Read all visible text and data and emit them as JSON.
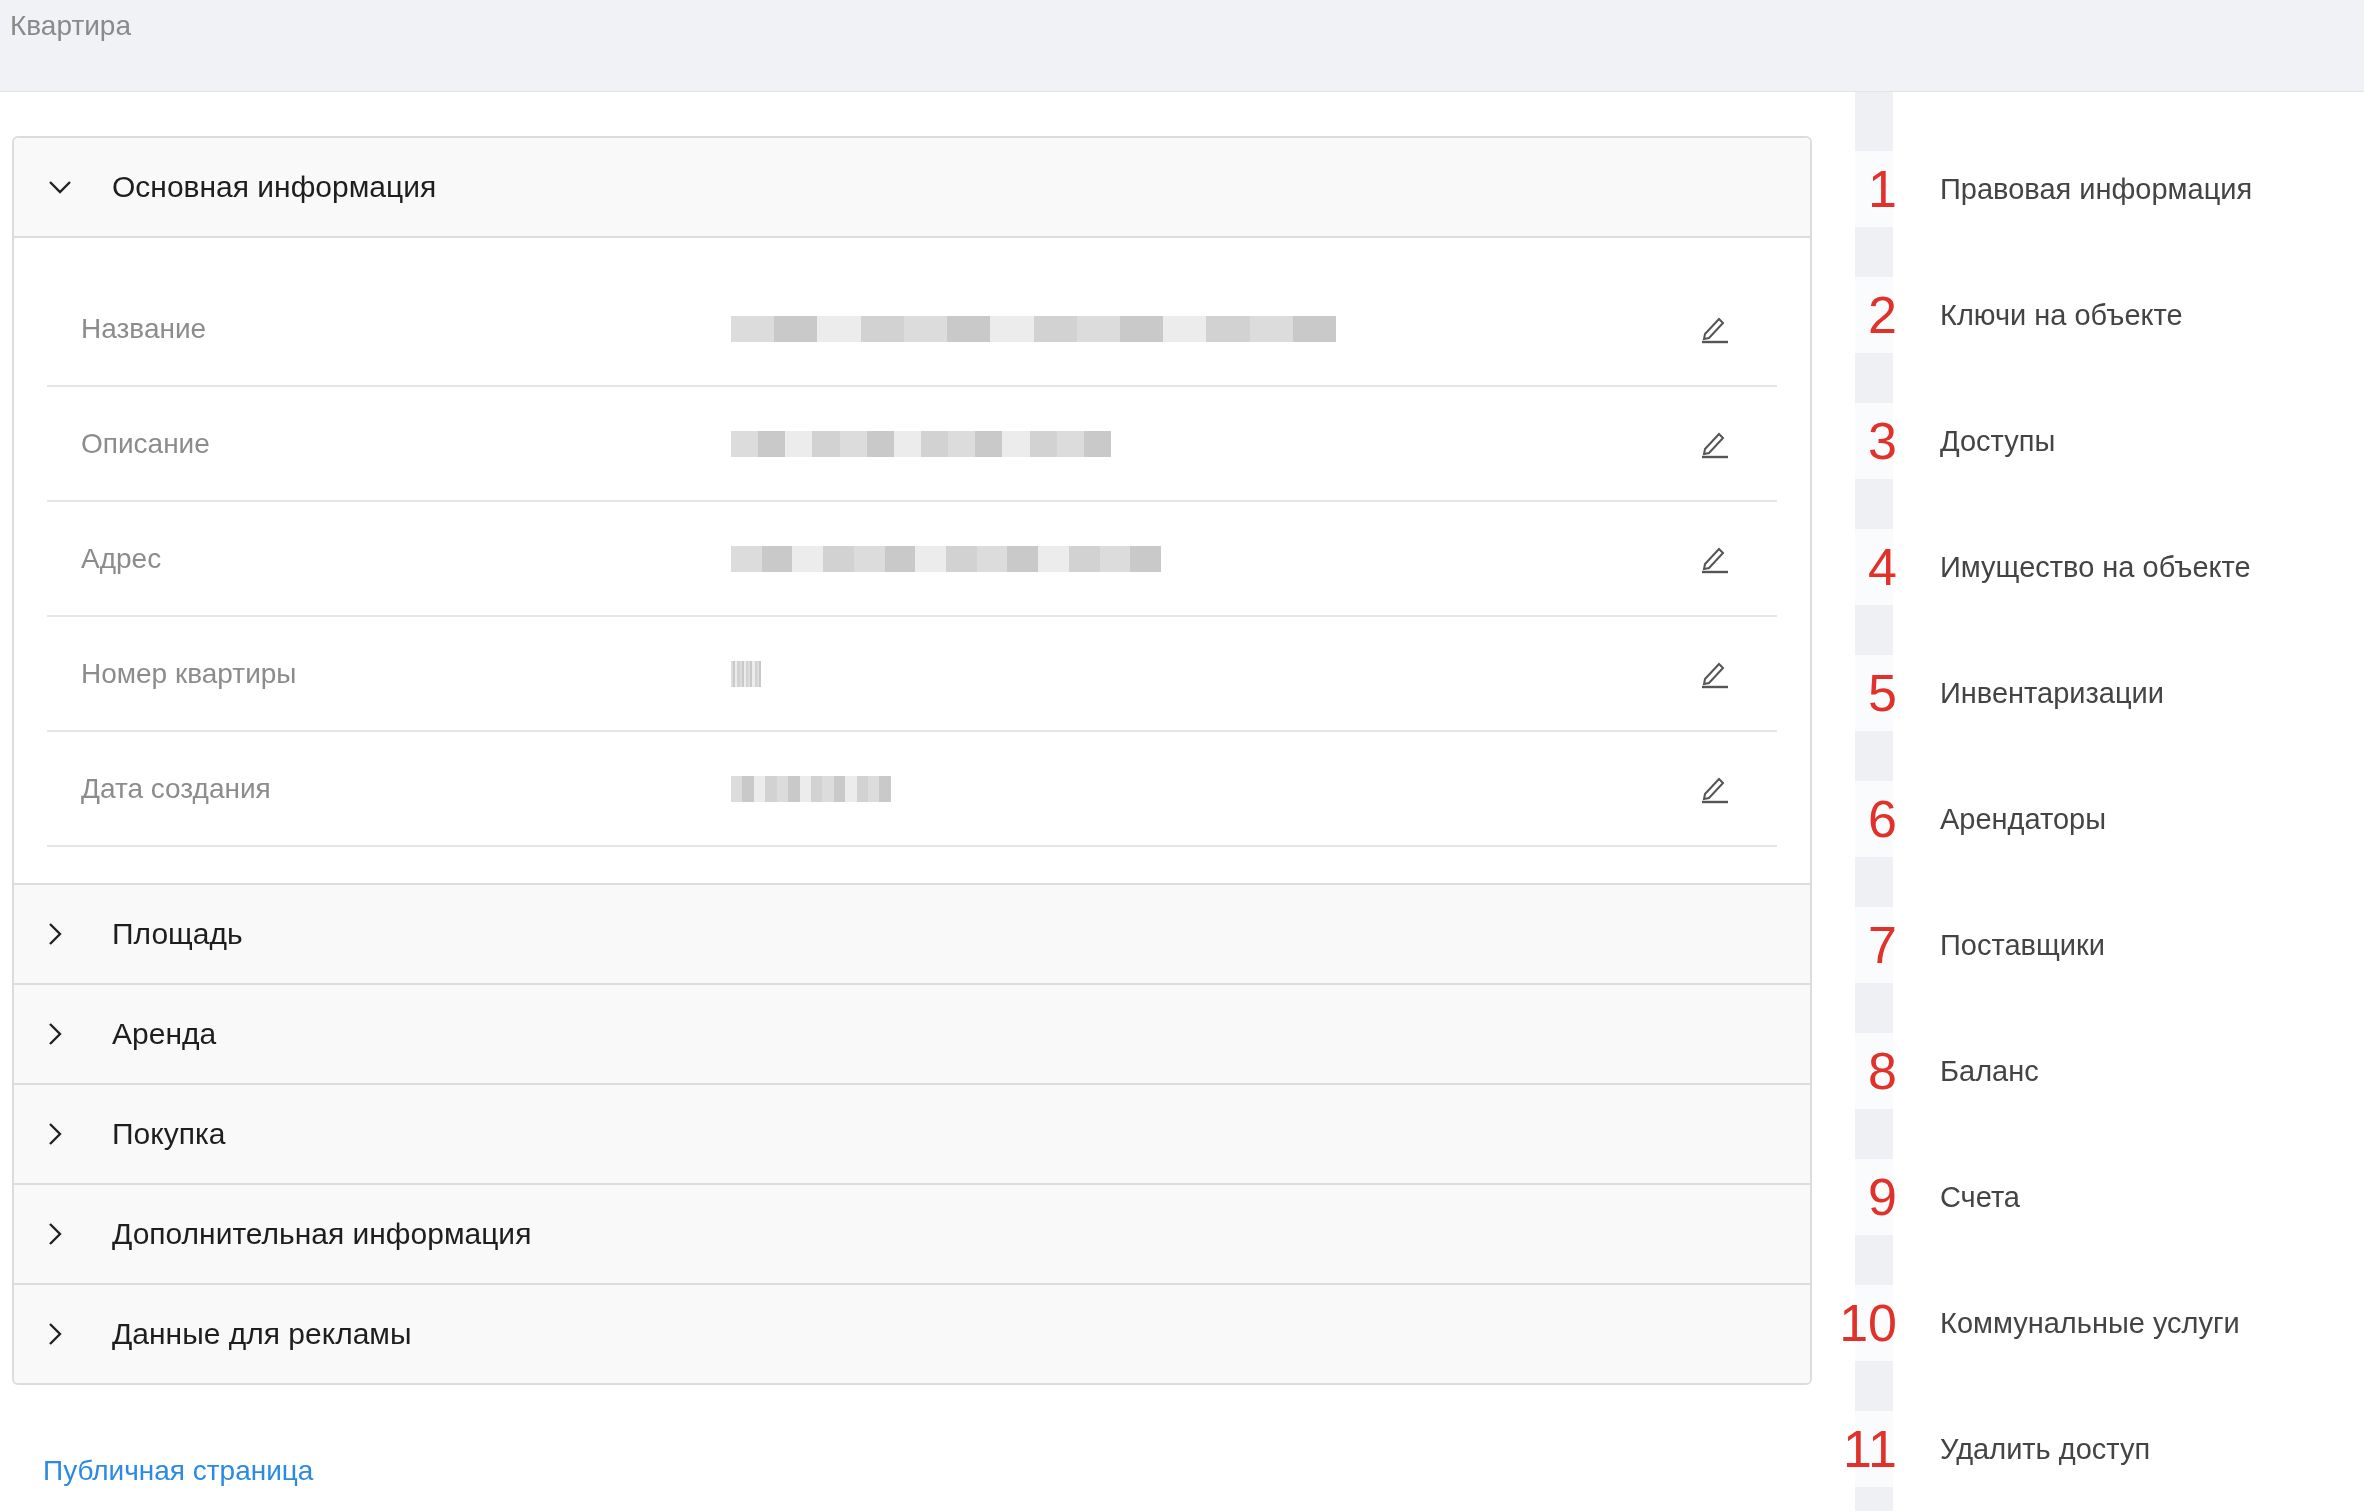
{
  "page": {
    "title": "Квартира"
  },
  "sections": [
    {
      "title": "Основная информация",
      "expanded": true,
      "fields": [
        {
          "label": "Название",
          "value_blurred": true
        },
        {
          "label": "Описание",
          "value_blurred": true
        },
        {
          "label": "Адрес",
          "value_blurred": true
        },
        {
          "label": "Номер квартиры",
          "value_blurred": true
        },
        {
          "label": "Дата создания",
          "value_blurred": true
        }
      ]
    },
    {
      "title": "Площадь",
      "expanded": false
    },
    {
      "title": "Аренда",
      "expanded": false
    },
    {
      "title": "Покупка",
      "expanded": false
    },
    {
      "title": "Дополнительная информация",
      "expanded": false
    },
    {
      "title": "Данные для рекламы",
      "expanded": false
    }
  ],
  "public_link": "Публичная страница",
  "side_nav": [
    {
      "label": "Правовая информация",
      "annotation": "1"
    },
    {
      "label": "Ключи на объекте",
      "annotation": "2"
    },
    {
      "label": "Доступы",
      "annotation": "3"
    },
    {
      "label": "Имущество на объекте",
      "annotation": "4"
    },
    {
      "label": "Инвентаризации",
      "annotation": "5"
    },
    {
      "label": "Арендаторы",
      "annotation": "6"
    },
    {
      "label": "Поставщики",
      "annotation": "7"
    },
    {
      "label": "Баланс",
      "annotation": "8"
    },
    {
      "label": "Счета",
      "annotation": "9"
    },
    {
      "label": "Коммунальные услуги",
      "annotation": "10"
    },
    {
      "label": "Удалить доступ",
      "annotation": "11"
    }
  ]
}
